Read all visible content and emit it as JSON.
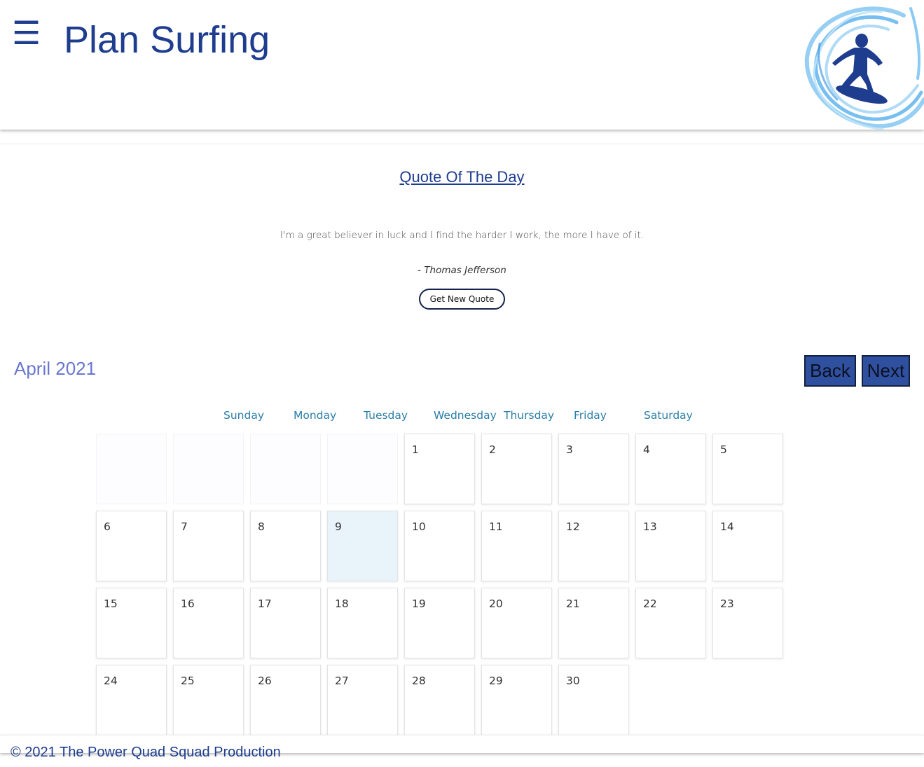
{
  "header": {
    "menu_glyph": "☰",
    "title": "Plan Surfing"
  },
  "quote": {
    "heading": "Quote Of The Day",
    "text": "I'm a great believer in luck and I find the harder I work, the more I have of it.",
    "author": "- Thomas Jefferson",
    "button_label": "Get New Quote"
  },
  "calendar": {
    "month_label": "April 2021",
    "back_label": "Back",
    "next_label": "Next",
    "weekdays": [
      "Sunday",
      "Monday",
      "Tuesday",
      "Wednesday",
      "Thursday",
      "Friday",
      "Saturday"
    ],
    "today": 9,
    "rows": [
      [
        "",
        "",
        "",
        "",
        "1",
        "2",
        "3",
        "4",
        "5"
      ],
      [
        "6",
        "7",
        "8",
        "9",
        "10",
        "11",
        "12",
        "13",
        "14"
      ],
      [
        "15",
        "16",
        "17",
        "18",
        "19",
        "20",
        "21",
        "22",
        "23"
      ],
      [
        "24",
        "25",
        "26",
        "27",
        "28",
        "29",
        "30"
      ]
    ]
  },
  "footer": {
    "text": "© 2021 The Power Quad Squad Production"
  },
  "colors": {
    "brand": "#1e3d8f",
    "month_label": "#6a76cf",
    "weekday": "#2a7ea8",
    "today_cell": "#e9f3fa",
    "nav_button": "#2f4f9f"
  }
}
